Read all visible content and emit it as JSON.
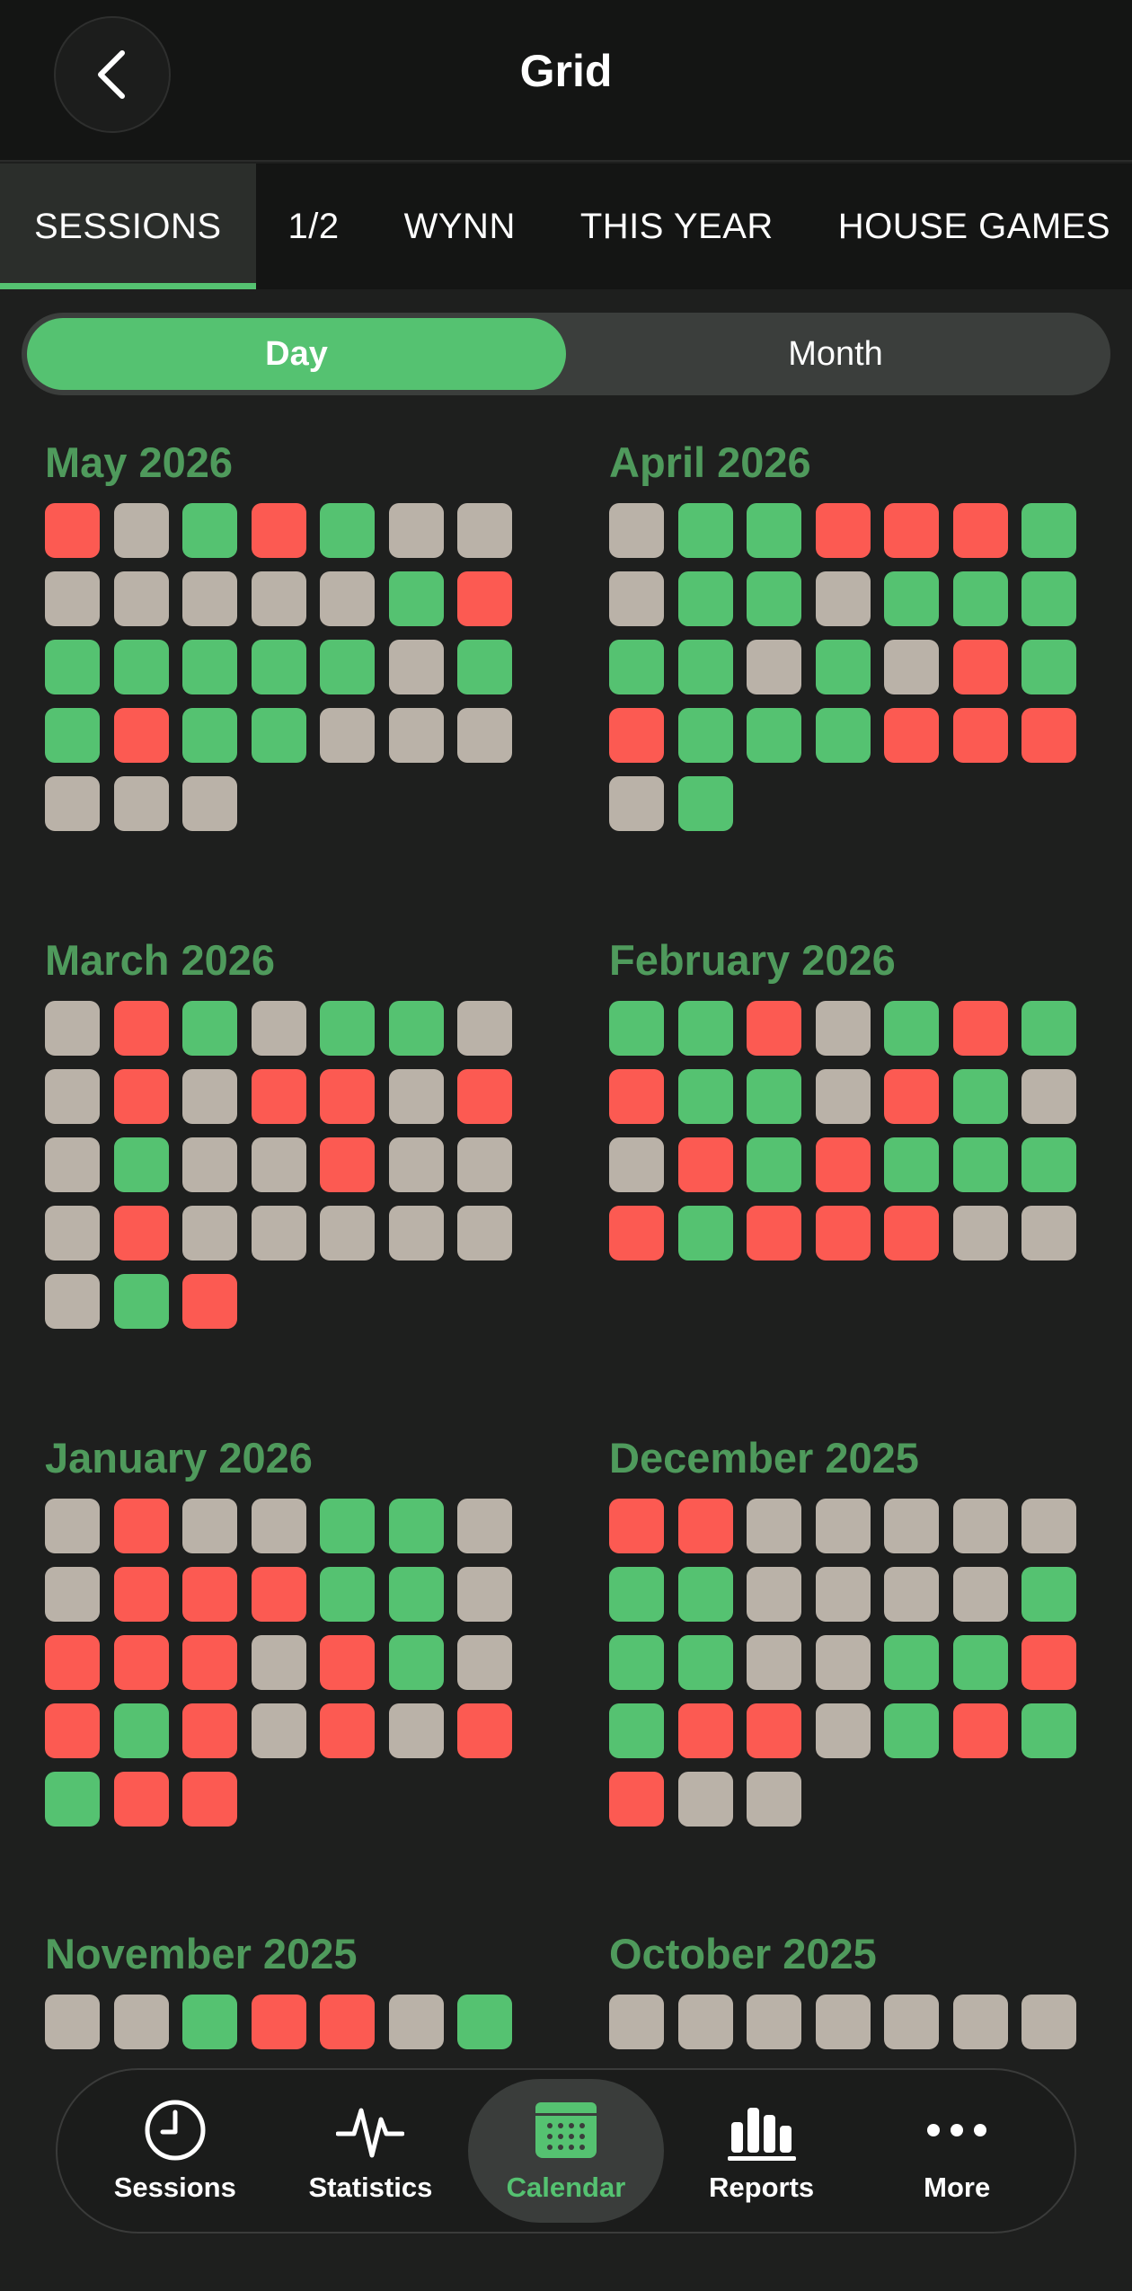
{
  "header": {
    "title": "Grid"
  },
  "tabs": [
    {
      "label": "SESSIONS",
      "active": true
    },
    {
      "label": "1/2",
      "active": false
    },
    {
      "label": "WYNN",
      "active": false
    },
    {
      "label": "THIS YEAR",
      "active": false
    },
    {
      "label": "HOUSE GAMES",
      "active": false
    }
  ],
  "segment": {
    "day": "Day",
    "month": "Month",
    "selected": "Day"
  },
  "legend_colors": {
    "win": "#55c271",
    "loss": "#fc5a52",
    "none": "#bab2a8"
  },
  "months": [
    {
      "title": "May 2026",
      "days": "lnwlwnn nnnnnwl wwwwwnw wlwwnnn nnn"
    },
    {
      "title": "April 2026",
      "days": "nwwlllw nwwnwww wwnwnlw lwwwlll nw"
    },
    {
      "title": "March 2026",
      "days": "nlwnwwn nlnllnl nwnnlnn nlnnnnn nwl"
    },
    {
      "title": "February 2026",
      "days": "wwlnwlw lwwnlwn nlwlwww lwlllnn"
    },
    {
      "title": "January 2026",
      "days": "nlnnwwn nlllwwn lllnlwn lwlnlnl wll"
    },
    {
      "title": "December 2025",
      "days": "llnnnnn wwnnnnw wwnnwwl wllnwlw lnn"
    },
    {
      "title": "November 2025",
      "days": "nnwllnw"
    },
    {
      "title": "October 2025",
      "days": "nnnnnnn"
    }
  ],
  "nav": [
    {
      "label": "Sessions",
      "icon": "clock-icon",
      "active": false
    },
    {
      "label": "Statistics",
      "icon": "pulse-icon",
      "active": false
    },
    {
      "label": "Calendar",
      "icon": "calendar-icon",
      "active": true
    },
    {
      "label": "Reports",
      "icon": "bar-chart-icon",
      "active": false
    },
    {
      "label": "More",
      "icon": "ellipsis-icon",
      "active": false
    }
  ]
}
